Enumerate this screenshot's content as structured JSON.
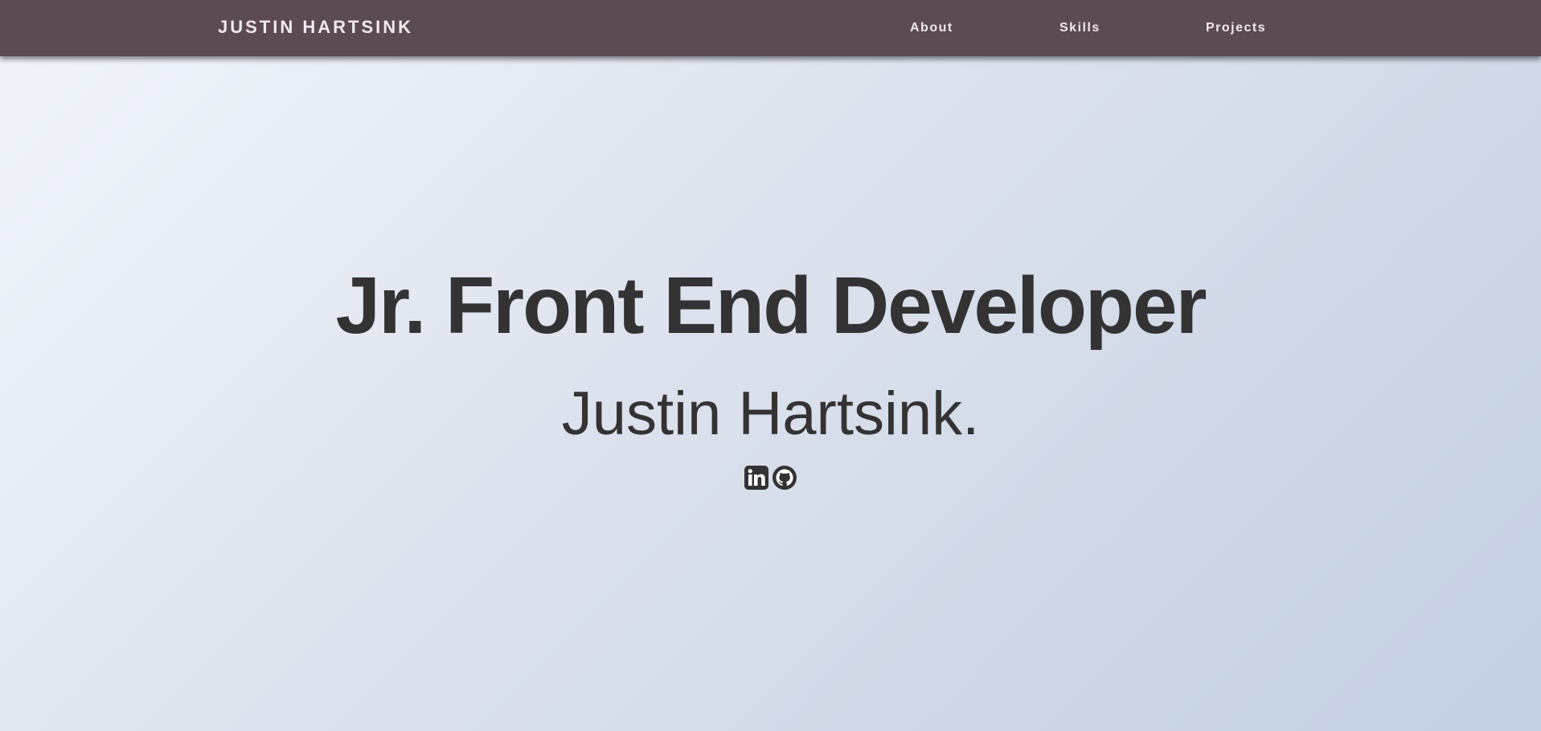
{
  "nav": {
    "brand": "JUSTIN HARTSINK",
    "links": [
      "About",
      "Skills",
      "Projects"
    ]
  },
  "hero": {
    "title": "Jr. Front End Developer",
    "name": "Justin Hartsink."
  },
  "social": {
    "icons": [
      "linkedin-icon",
      "github-icon"
    ]
  },
  "colors": {
    "navbar": "#5c4a55",
    "nav_text": "#f1eaed",
    "heading_text": "#333333",
    "background_start": "#f2f5fb",
    "background_end": "#c3cfe2"
  }
}
